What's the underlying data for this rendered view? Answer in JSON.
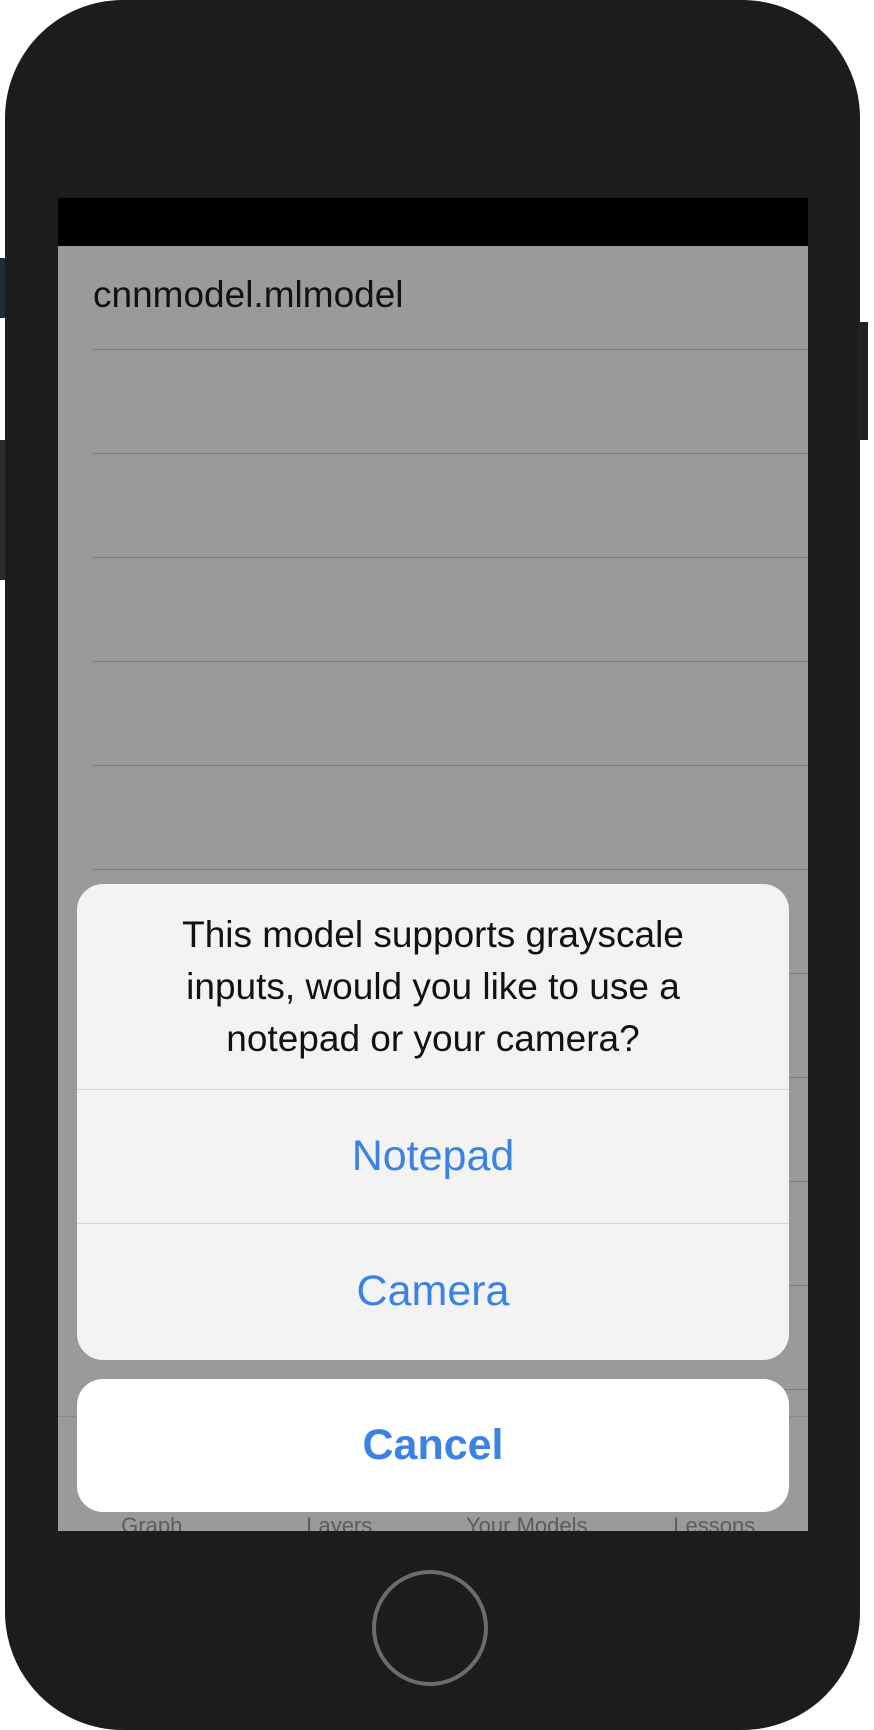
{
  "table": {
    "rows": [
      {
        "label": "cnnmodel.mlmodel"
      },
      {
        "label": ""
      },
      {
        "label": ""
      },
      {
        "label": ""
      },
      {
        "label": ""
      },
      {
        "label": ""
      },
      {
        "label": ""
      },
      {
        "label": ""
      },
      {
        "label": ""
      },
      {
        "label": ""
      },
      {
        "label": ""
      }
    ]
  },
  "tabbar": {
    "tabs": [
      {
        "label": "Graph"
      },
      {
        "label": "Layers"
      },
      {
        "label": "Your Models"
      },
      {
        "label": "Lessons"
      }
    ]
  },
  "action_sheet": {
    "message": "This model supports grayscale inputs, would you like to use a notepad or your camera?",
    "notepad_label": "Notepad",
    "camera_label": "Camera",
    "cancel_label": "Cancel"
  },
  "colors": {
    "accent": "#3a82e4",
    "dim_overlay": "#9a9a9a",
    "phone_frame": "#1c1c1c"
  }
}
